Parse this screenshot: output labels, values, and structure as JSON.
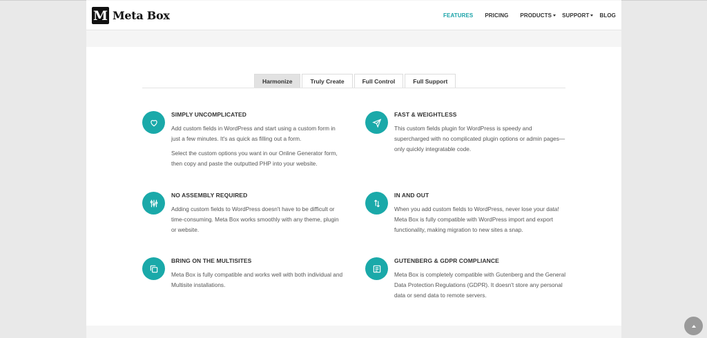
{
  "brand": {
    "logo_letter": "M",
    "name": "Meta Box"
  },
  "nav": [
    {
      "label": "FEATURES",
      "active": true,
      "dropdown": false
    },
    {
      "label": "PRICING",
      "active": false,
      "dropdown": false
    },
    {
      "label": "PRODUCTS",
      "active": false,
      "dropdown": true
    },
    {
      "label": "SUPPORT",
      "active": false,
      "dropdown": true
    },
    {
      "label": "BLOG",
      "active": false,
      "dropdown": false
    }
  ],
  "tabs": [
    {
      "label": "Harmonize",
      "active": true
    },
    {
      "label": "Truly Create",
      "active": false
    },
    {
      "label": "Full Control",
      "active": false
    },
    {
      "label": "Full Support",
      "active": false
    }
  ],
  "features": [
    {
      "icon": "heart-icon",
      "title": "SIMPLY UNCOMPLICATED",
      "paragraphs": [
        "Add custom fields in WordPress and start using a custom form in just a few minutes. It's as quick as filling out a form.",
        "Select the custom options you want in our Online Generator form, then copy and paste the outputted PHP into your website."
      ]
    },
    {
      "icon": "paper-plane-icon",
      "title": "FAST & WEIGHTLESS",
      "paragraphs": [
        "This custom fields plugin for WordPress is speedy and supercharged with no complicated plugin options or admin pages—only quickly integratable code."
      ]
    },
    {
      "icon": "sliders-icon",
      "title": "NO ASSEMBLY REQUIRED",
      "paragraphs": [
        "Adding custom fields to WordPress doesn't have to be difficult or time-consuming. Meta Box works smoothly with any theme, plugin or website."
      ]
    },
    {
      "icon": "arrows-up-down-icon",
      "title": "IN AND OUT",
      "paragraphs": [
        "When you add custom fields to WordPress, never lose your data! Meta Box is fully compatible with WordPress import and export functionality, making migration to new sites a snap."
      ]
    },
    {
      "icon": "copy-icon",
      "title": "BRING ON THE MULTISITES",
      "paragraphs": [
        "Meta Box is fully compatible and works well with both individual and Multisite installations."
      ]
    },
    {
      "icon": "document-icon",
      "title": "GUTENBERG & GDPR COMPLIANCE",
      "paragraphs": [
        "Meta Box is completely compatible with Gutenberg and the General Data Protection Regulations (GDPR). It doesn't store any personal data or send data to remote servers."
      ]
    }
  ],
  "colors": {
    "accent": "#1aa9a9",
    "active_nav": "#1aa3a8"
  }
}
